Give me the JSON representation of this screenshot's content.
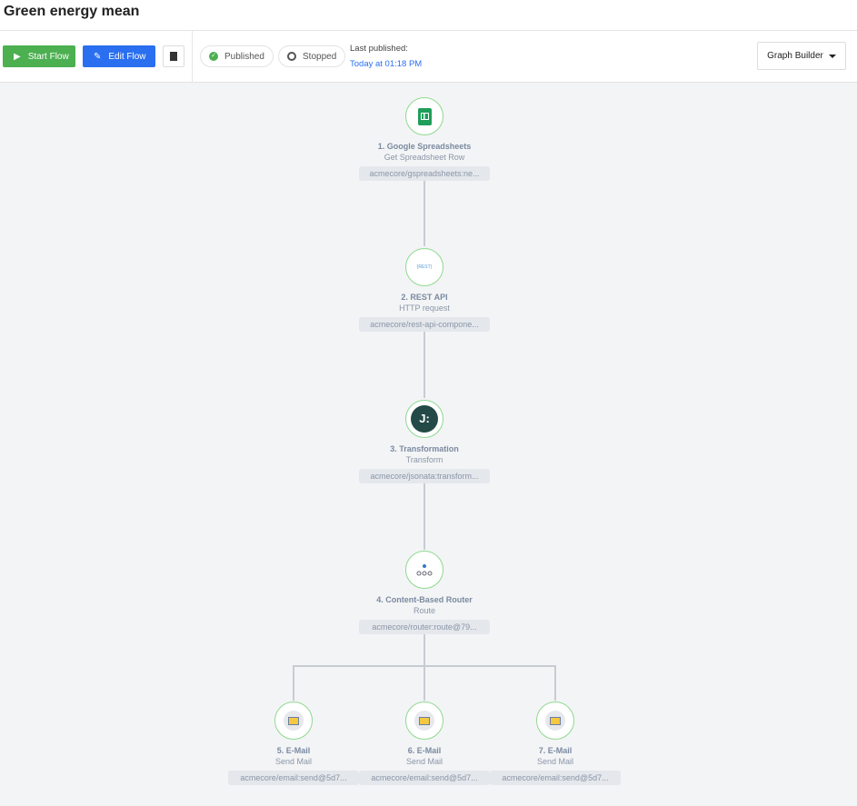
{
  "header": {
    "title": "Green energy mean"
  },
  "toolbar": {
    "start_label": "Start Flow",
    "edit_label": "Edit Flow",
    "published_label": "Published",
    "stopped_label": "Stopped",
    "last_published_label": "Last published:",
    "last_published_value": "Today at 01:18 PM",
    "view_select": "Graph Builder"
  },
  "nodes": [
    {
      "title": "1. Google Spreadsheets",
      "subtitle": "Get Spreadsheet Row",
      "component": "acmecore/gspreadsheets:ne...",
      "icon": "google-sheets-icon"
    },
    {
      "title": "2. REST API",
      "subtitle": "HTTP request",
      "component": "acmecore/rest-api-compone...",
      "icon": "rest-api-icon",
      "icon_text": "{REST}"
    },
    {
      "title": "3. Transformation",
      "subtitle": "Transform",
      "component": "acmecore/jsonata:transform...",
      "icon": "jsonata-icon",
      "icon_text": "J:"
    },
    {
      "title": "4. Content-Based Router",
      "subtitle": "Route",
      "component": "acmecore/router:route@79...",
      "icon": "router-icon"
    },
    {
      "title": "5. E-Mail",
      "subtitle": "Send Mail",
      "component": "acmecore/email:send@5d7...",
      "icon": "email-icon"
    },
    {
      "title": "6. E-Mail",
      "subtitle": "Send Mail",
      "component": "acmecore/email:send@5d7...",
      "icon": "email-icon"
    },
    {
      "title": "7. E-Mail",
      "subtitle": "Send Mail",
      "component": "acmecore/email:send@5d7...",
      "icon": "email-icon"
    }
  ]
}
